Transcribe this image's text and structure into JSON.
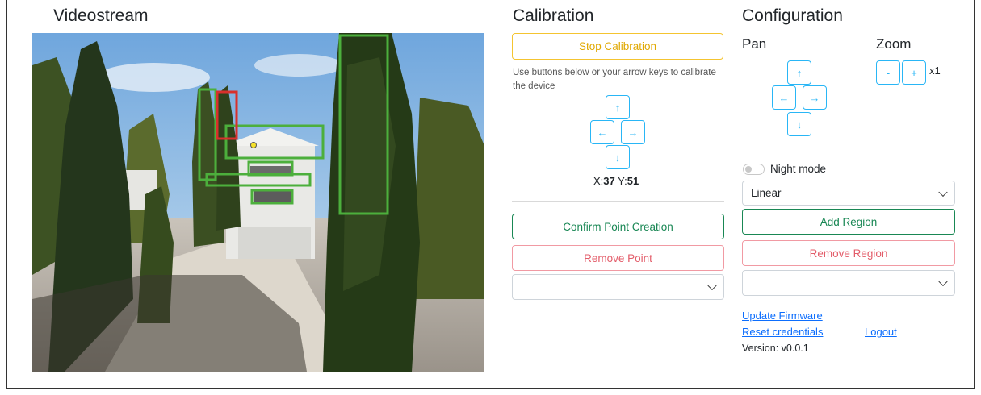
{
  "sections": {
    "video_title": "Videostream",
    "calibration_title": "Calibration",
    "configuration_title": "Configuration"
  },
  "calibration": {
    "stop_button": "Stop Calibration",
    "hint": "Use buttons below or your arrow keys to calibrate the device",
    "arrows": {
      "up": "↑",
      "left": "←",
      "right": "→",
      "down": "↓"
    },
    "x_label": "X:",
    "x_value": "37",
    "y_label": "Y:",
    "y_value": "51",
    "confirm_button": "Confirm Point Creation",
    "remove_point_button": "Remove Point",
    "point_select_value": ""
  },
  "configuration": {
    "pan_label": "Pan",
    "zoom_label": "Zoom",
    "pan_arrows": {
      "up": "↑",
      "left": "←",
      "right": "→",
      "down": "↓"
    },
    "zoom_minus": "-",
    "zoom_plus": "+",
    "zoom_value": "x1",
    "night_mode_label": "Night mode",
    "night_mode_on": false,
    "mode_select_value": "Linear",
    "add_region_button": "Add Region",
    "remove_region_button": "Remove Region",
    "region_select_value": "",
    "update_firmware_link": "Update Firmware",
    "reset_credentials_link": "Reset credentials",
    "logout_link": "Logout",
    "version_text": "Version: v0.0.1"
  },
  "colors": {
    "warning": "#f4c430",
    "success": "#198754",
    "danger": "#e35d6a",
    "arrow": "#29b6f6",
    "link": "#0d6efd",
    "overlay_green": "#4caf3c",
    "overlay_red": "#d8302c"
  }
}
